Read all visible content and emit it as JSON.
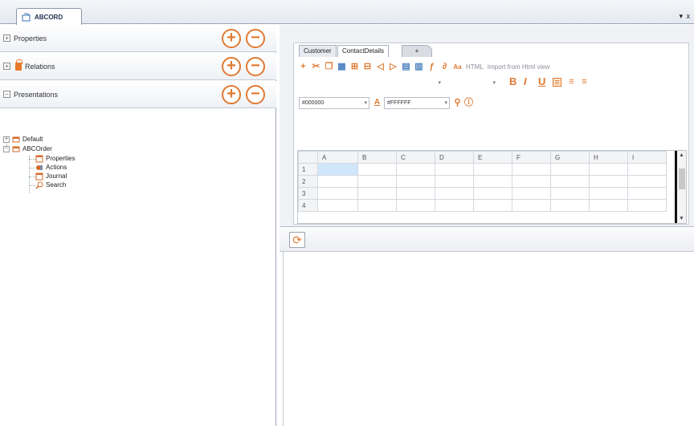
{
  "window": {
    "tab_title": "ABCORD",
    "controls": "▾ x"
  },
  "left_panel": {
    "sections": [
      {
        "label": "Properties",
        "expander": "⊞"
      },
      {
        "label": "Relations",
        "expander": "⊞"
      },
      {
        "label": "Presentations",
        "expander": "⊟"
      }
    ],
    "tree": {
      "items": [
        {
          "label": "Default"
        },
        {
          "label": "ABCOrder"
        },
        {
          "label": "Properties"
        },
        {
          "label": "Actions"
        },
        {
          "label": "Journal"
        },
        {
          "label": "Search"
        }
      ]
    }
  },
  "editor": {
    "tabs": [
      "Customer",
      "ContactDetails",
      "+"
    ],
    "toolbar": {
      "html_label": "HTML",
      "import_label": "Import from Html view",
      "bold": "B",
      "italic": "I",
      "underline": "U",
      "fore_color": "#000000",
      "back_color": "#FFFFFF"
    },
    "grid": {
      "columns": [
        "A",
        "B",
        "C",
        "D",
        "E",
        "F",
        "G",
        "H",
        "I"
      ],
      "rows": [
        "1",
        "2",
        "3",
        "4"
      ]
    }
  },
  "colors": {
    "accent": "#e07a33",
    "selection": "#cfe6fb"
  }
}
